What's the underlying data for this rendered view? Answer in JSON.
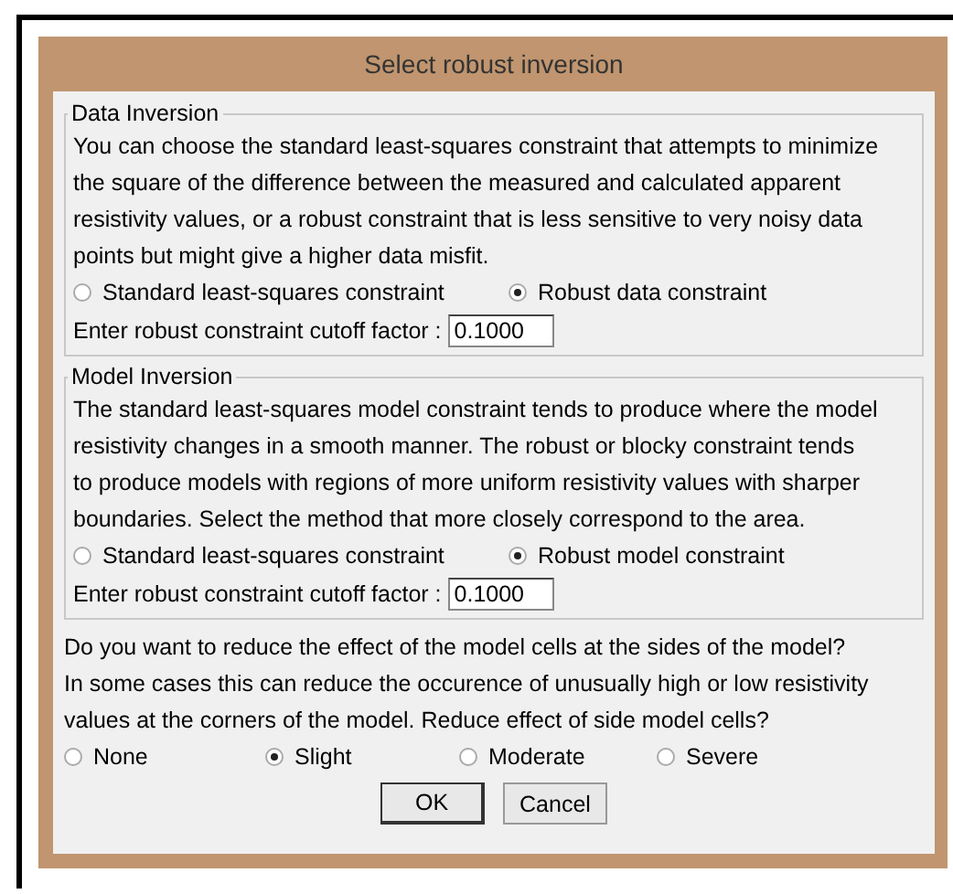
{
  "window": {
    "title": "Select robust inversion"
  },
  "groups": [
    {
      "title": "Data Inversion",
      "description": "You can choose the standard least-squares constraint that attempts to minimize\nthe square of the difference between the measured and calculated apparent\nresistivity values, or a robust constraint that is less sensitive to very noisy data\npoints but might give a higher data misfit.",
      "options": [
        {
          "label": "Standard least-squares constraint",
          "selected": false
        },
        {
          "label": "Robust data constraint",
          "selected": true
        }
      ],
      "cutoff": {
        "label": "Enter robust constraint cutoff factor :",
        "value": "0.1000"
      }
    },
    {
      "title": "Model Inversion",
      "description": "The standard least-squares model constraint tends to produce where the model\nresistivity changes in a smooth manner. The robust or blocky constraint tends\nto produce models with regions of more uniform resistivity values with sharper\nboundaries. Select the method that more closely correspond to the area.",
      "options": [
        {
          "label": "Standard least-squares constraint",
          "selected": false
        },
        {
          "label": "Robust model constraint",
          "selected": true
        }
      ],
      "cutoff": {
        "label": "Enter robust constraint cutoff factor :",
        "value": "0.1000"
      }
    }
  ],
  "side_cells": {
    "question": "Do you want to reduce the effect of the model cells at the sides of the model?\nIn some cases this can reduce the occurence of unusually high or low resistivity\nvalues at the corners of the model. Reduce effect of side model cells?",
    "options": [
      {
        "label": "None",
        "selected": false
      },
      {
        "label": "Slight",
        "selected": true
      },
      {
        "label": "Moderate",
        "selected": false
      },
      {
        "label": "Severe",
        "selected": false
      }
    ]
  },
  "buttons": [
    {
      "label": "OK",
      "default": true
    },
    {
      "label": "Cancel",
      "default": false
    }
  ]
}
